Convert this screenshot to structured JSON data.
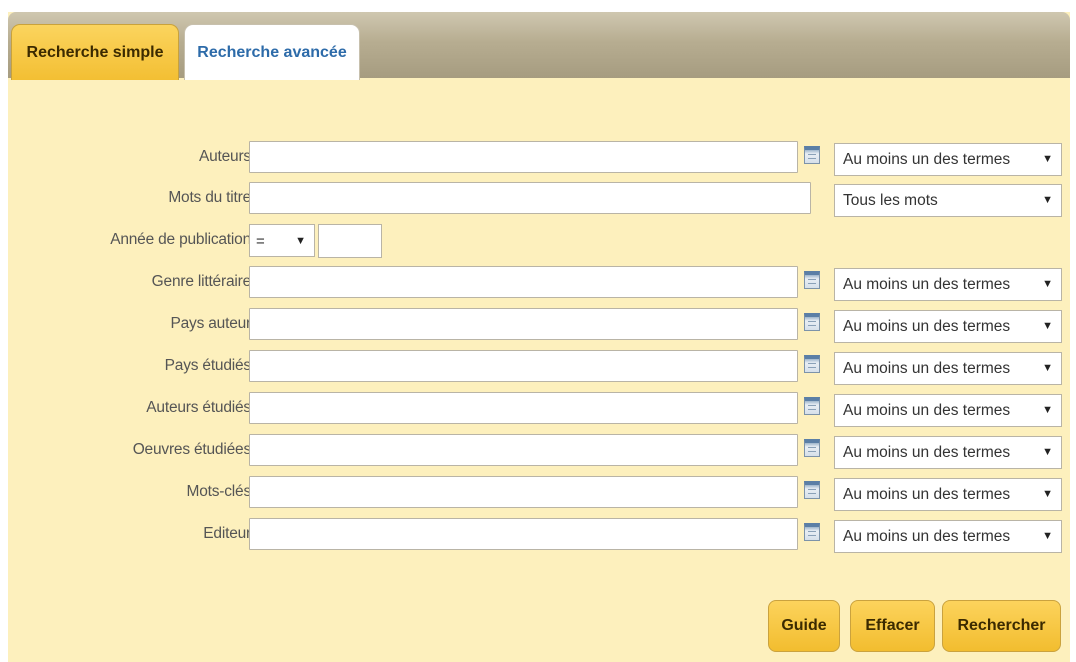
{
  "tabs": {
    "simple": "Recherche simple",
    "advanced": "Recherche avancée"
  },
  "fields": {
    "auteurs": {
      "label": "Auteurs",
      "value": "",
      "mode": "Au moins un des termes"
    },
    "titre": {
      "label": "Mots du titre",
      "value": "",
      "mode": "Tous les mots"
    },
    "annee": {
      "label": "Année de publication",
      "operator": "=",
      "value": ""
    },
    "genre": {
      "label": "Genre littéraire",
      "value": "",
      "mode": "Au moins un des termes"
    },
    "pays_auteur": {
      "label": "Pays auteur",
      "value": "",
      "mode": "Au moins un des termes"
    },
    "pays_etudies": {
      "label": "Pays étudiés",
      "value": "",
      "mode": "Au moins un des termes"
    },
    "auteurs_etudies": {
      "label": "Auteurs étudiés",
      "value": "",
      "mode": "Au moins un des termes"
    },
    "oeuvres_etudiees": {
      "label": "Oeuvres étudiées",
      "value": "",
      "mode": "Au moins un des termes"
    },
    "mots_cles": {
      "label": "Mots-clés",
      "value": "",
      "mode": "Au moins un des termes"
    },
    "editeur": {
      "label": "Editeur",
      "value": "",
      "mode": "Au moins un des termes"
    }
  },
  "dropdown_arrow": "▼",
  "icons": {
    "list": "calendar-list-icon"
  },
  "buttons": {
    "guide": "Guide",
    "effacer": "Effacer",
    "rechercher": "Rechercher"
  },
  "colors": {
    "background": "#fdf0bd",
    "tab_active_text": "#2d6ba9",
    "button": "#f5c43f"
  }
}
